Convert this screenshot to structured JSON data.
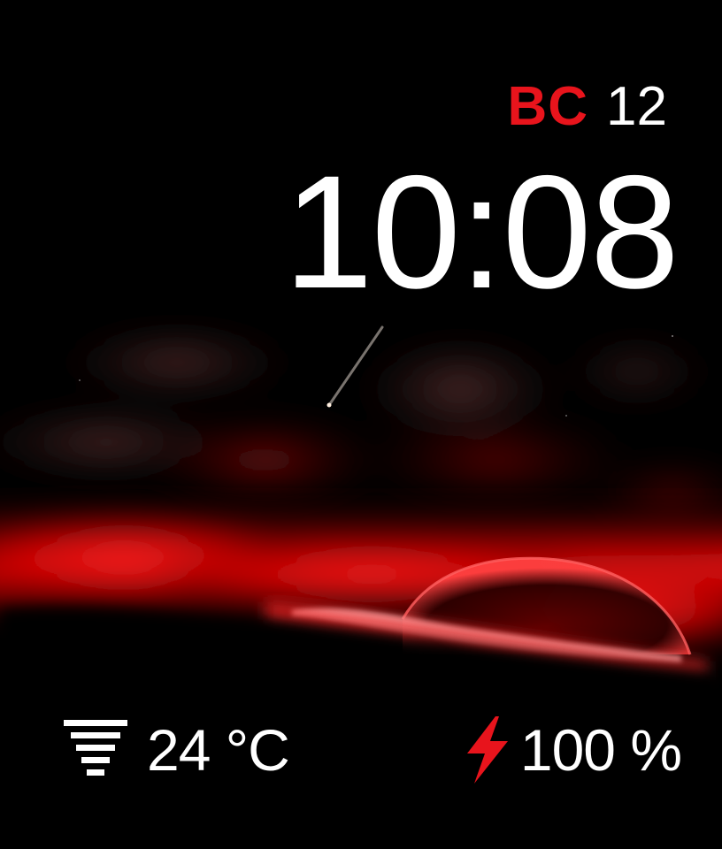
{
  "date": {
    "day_name": "BC",
    "day_number": "12"
  },
  "time": "10:08",
  "weather": {
    "icon": "wind-icon",
    "temperature": "24 °C"
  },
  "battery": {
    "icon": "lightning-bolt-icon",
    "level": "100 %"
  },
  "colors": {
    "accent": "#e8141c",
    "text": "#ffffff",
    "background": "#000000"
  }
}
